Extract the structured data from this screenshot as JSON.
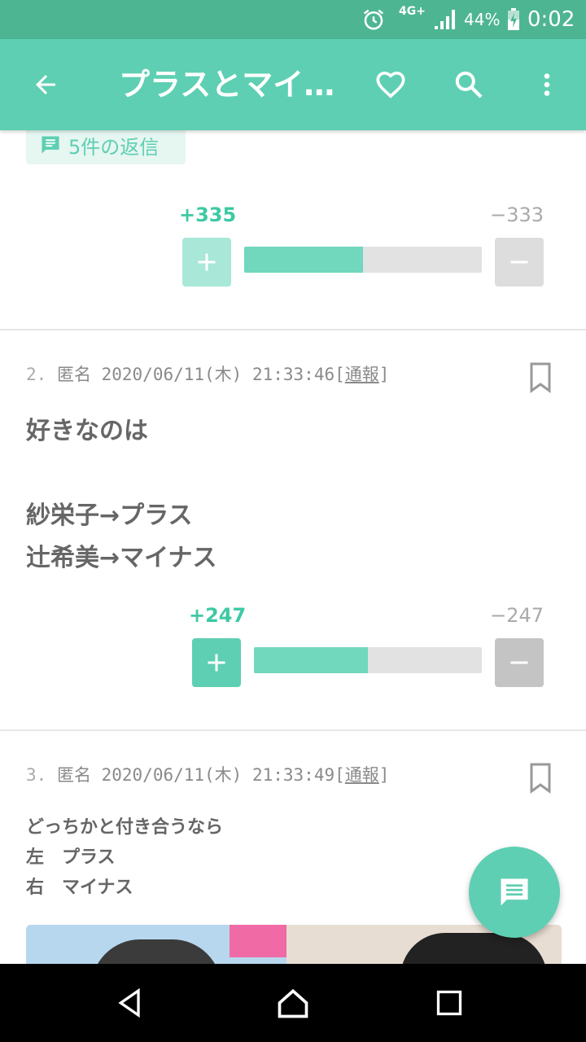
{
  "status_bar": {
    "network": "4G+",
    "battery_percent": "44%",
    "time": "0:02",
    "icons": [
      "alarm-icon",
      "signal-icon",
      "battery-charging-icon"
    ]
  },
  "app_bar": {
    "title": "プラスとマイ…",
    "icons": [
      "arrow-back-icon",
      "heart-icon",
      "search-icon",
      "more-vert-icon"
    ]
  },
  "replies_chip": {
    "label": "5件の返信",
    "icon": "comment-icon"
  },
  "posts": [
    {
      "plus_label": "+335",
      "minus_label": "−333",
      "plus_ratio": 0.501
    },
    {
      "number": "2.",
      "author": "匿名",
      "datetime": "2020/06/11(木) 21:33:46",
      "report_open": "[",
      "report": "通報",
      "report_close": "]",
      "lines": [
        "好きなのは",
        "",
        "紗栄子→プラス",
        "辻希美→マイナス"
      ],
      "plus_label": "+247",
      "minus_label": "−247",
      "plus_ratio": 0.5
    },
    {
      "number": "3.",
      "author": "匿名",
      "datetime": "2020/06/11(木) 21:33:49",
      "report_open": "[",
      "report": "通報",
      "report_close": "]",
      "lines": [
        "どっちかと付き合うなら",
        "左　プラス",
        "右　マイナス"
      ]
    }
  ],
  "colors": {
    "status_bar": "#4eb593",
    "app_bar": "#5ecfb2",
    "plus_count": "#3dc9a4",
    "bar_fill": "#71d7bd",
    "bar_track": "#e2e2e2",
    "minus_button": "#c4c4c4"
  },
  "fab": {
    "icon": "comment-icon"
  },
  "nav_bar": {
    "icons": [
      "nav-back-icon",
      "nav-home-icon",
      "nav-recents-icon"
    ]
  }
}
